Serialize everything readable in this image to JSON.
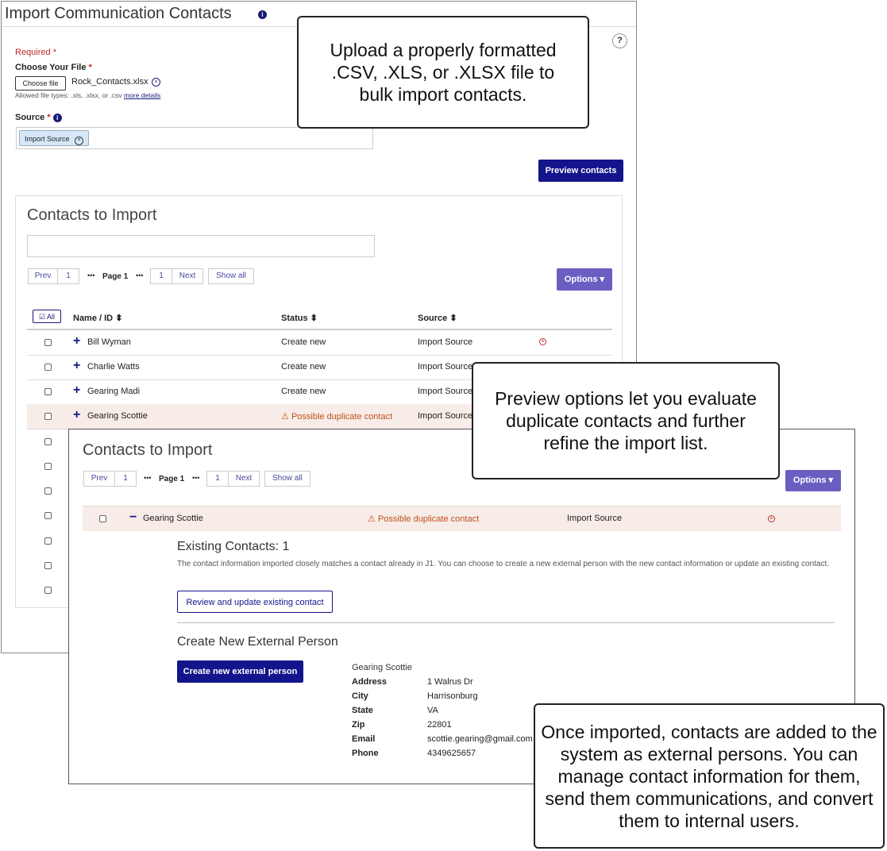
{
  "page": {
    "title": "Import Communication Contacts",
    "required_label": "Required",
    "help_icon": "?",
    "file_label": "Choose Your File",
    "choose_file_button": "Choose file",
    "file_name": "Rock_Contacts.xlsx",
    "allowed_types": "Allowed file types: .xls, .xlsx, or .csv",
    "more_details": "more details",
    "source_label": "Source",
    "source_tag": "Import Source",
    "preview_button": "Preview contacts"
  },
  "contacts": {
    "title": "Contacts to Import",
    "search_placeholder": "",
    "pagination": {
      "prev": "Prev",
      "first": "1",
      "ellipsis": "•••",
      "page": "Page 1",
      "last": "1",
      "next": "Next",
      "show_all": "Show all"
    },
    "options_button": "Options",
    "select_all": "All",
    "columns": {
      "name": "Name / ID",
      "status": "Status",
      "source": "Source"
    },
    "rows": [
      {
        "name": "Bill Wyman",
        "status": "Create new",
        "source": "Import Source"
      },
      {
        "name": "Charlie Watts",
        "status": "Create new",
        "source": "Import Source"
      },
      {
        "name": "Gearing Madi",
        "status": "Create new",
        "source": "Import Source"
      },
      {
        "name": "Gearing Scottie",
        "status": "Possible duplicate contact",
        "source": "Import Source"
      }
    ]
  },
  "detail": {
    "title": "Contacts to Import",
    "pagination": {
      "prev": "Prev",
      "first": "1",
      "ellipsis": "•••",
      "page": "Page 1",
      "last": "1",
      "next": "Next",
      "show_all": "Show all"
    },
    "options_button": "Options",
    "row": {
      "name": "Gearing Scottie",
      "status": "Possible duplicate contact",
      "source": "Import Source"
    },
    "existing_title": "Existing Contacts: 1",
    "existing_text": "The contact information imported closely matches a contact already in J1. You can choose to create a new external person with the new contact information or update an existing contact.",
    "review_button": "Review and update existing contact",
    "create_title": "Create New External Person",
    "create_button": "Create new external person",
    "person": {
      "name": "Gearing Scottie",
      "fields": [
        {
          "label": "Address",
          "value": "1 Walrus Dr"
        },
        {
          "label": "City",
          "value": "Harrisonburg"
        },
        {
          "label": "State",
          "value": "VA"
        },
        {
          "label": "Zip",
          "value": "22801"
        },
        {
          "label": "Email",
          "value": "scottie.gearing@gmail.com"
        },
        {
          "label": "Phone",
          "value": "4349625657"
        }
      ]
    }
  },
  "callouts": {
    "upload": "Upload a properly formatted .CSV, .XLS, or .XLSX file to bulk import contacts.",
    "preview": "Preview options let you evaluate duplicate contacts and further refine the import list.",
    "imported": "Once imported, contacts are added to the system as external persons. You can manage contact information for them, send them communications, and convert them to internal users."
  },
  "colors": {
    "primary": "#14148c",
    "purple": "#6a5fc1",
    "required": "#c0282a",
    "warning": "#c0501a",
    "highlight_row": "#f7ece8"
  }
}
